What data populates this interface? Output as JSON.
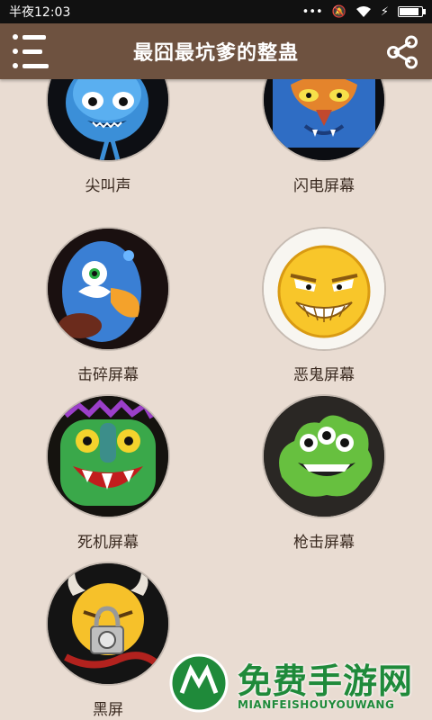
{
  "status_bar": {
    "time": "半夜12:03",
    "icons": [
      "more-icon",
      "mute-icon",
      "wifi-icon",
      "charging-icon",
      "battery-icon"
    ],
    "battery_level": 0.9
  },
  "app_bar": {
    "title": "最囧最坑爹的整蛊",
    "background": "#6e5240"
  },
  "items": [
    {
      "label": "尖叫声",
      "icon": "screaming-blob-monster-icon"
    },
    {
      "label": "闪电屏幕",
      "icon": "blue-owl-monster-icon"
    },
    {
      "label": "击碎屏幕",
      "icon": "blue-bird-monster-icon"
    },
    {
      "label": "恶鬼屏幕",
      "icon": "evil-grin-face-icon"
    },
    {
      "label": "死机屏幕",
      "icon": "green-fanged-monster-icon"
    },
    {
      "label": "枪击屏幕",
      "icon": "green-three-eyed-blob-icon"
    },
    {
      "label": "黑屏",
      "icon": "horned-face-padlock-icon"
    }
  ],
  "watermark": {
    "text": "免费手游网",
    "subtext": "MIANFEISHOUYOUWANG",
    "color": "#1f8a3a"
  }
}
